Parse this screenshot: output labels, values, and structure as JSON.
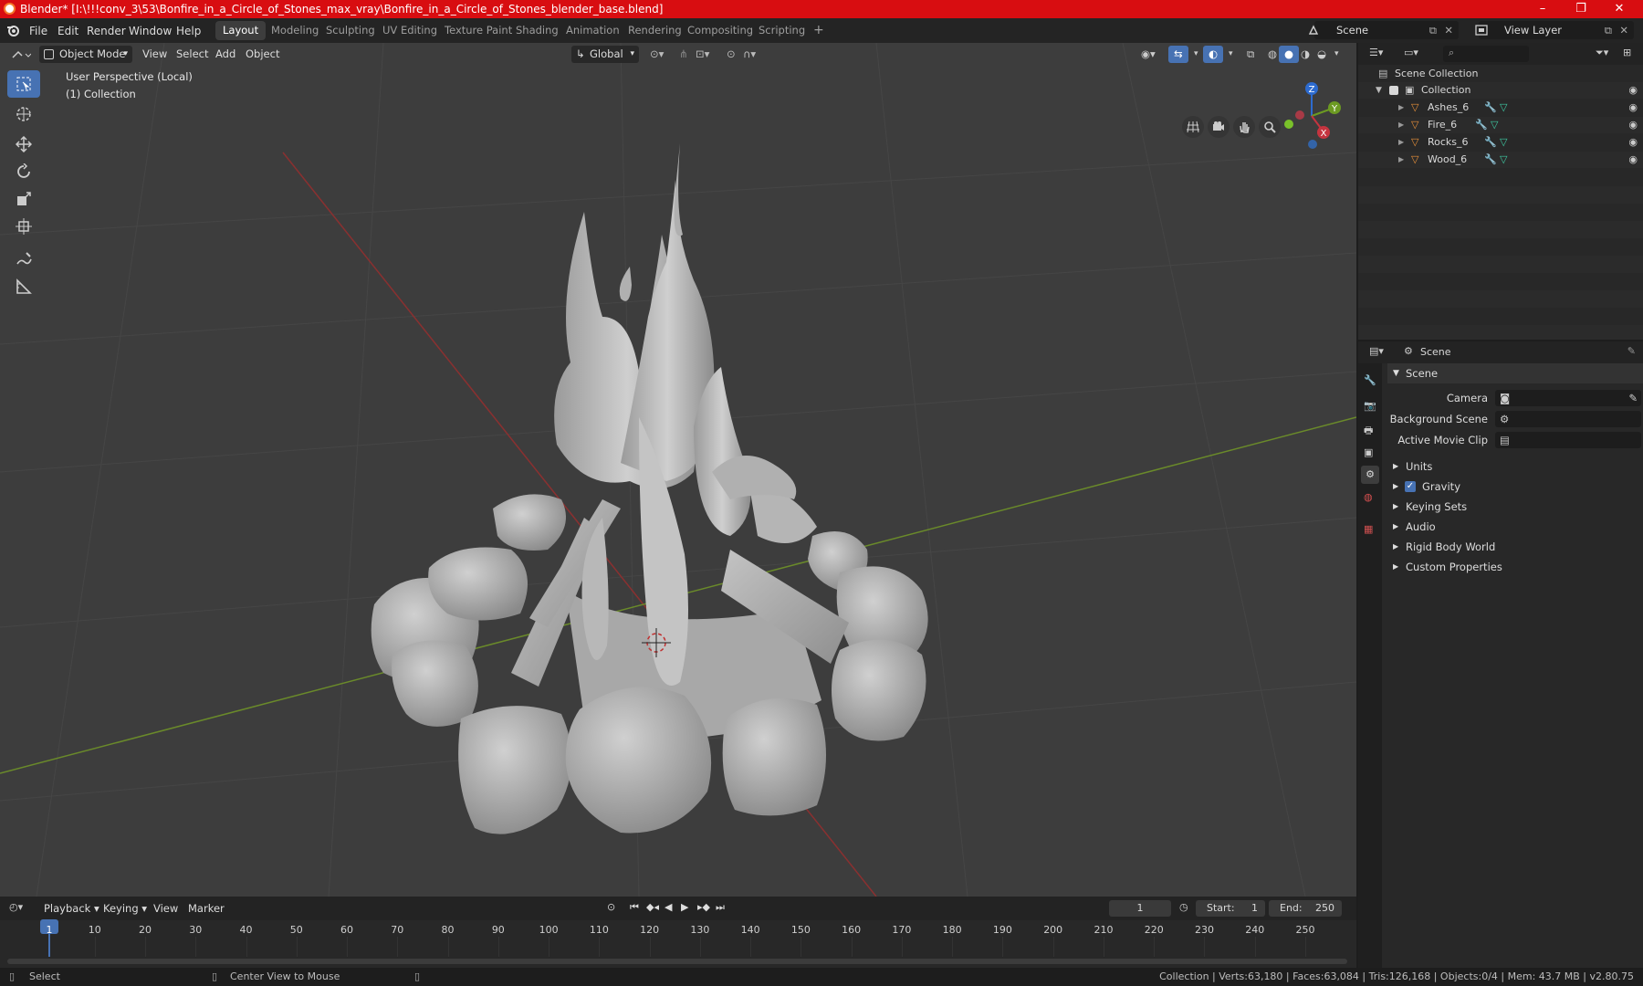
{
  "window": {
    "title": "Blender* [I:\\!!!conv_3\\53\\Bonfire_in_a_Circle_of_Stones_max_vray\\Bonfire_in_a_Circle_of_Stones_blender_base.blend]",
    "controls": {
      "minimize": "–",
      "maximize": "❐",
      "close": "✕"
    },
    "accent": "#d80d11"
  },
  "menu": [
    "File",
    "Edit",
    "Render",
    "Window",
    "Help"
  ],
  "workspaces": [
    "Layout",
    "Modeling",
    "Sculpting",
    "UV Editing",
    "Texture Paint",
    "Shading",
    "Animation",
    "Rendering",
    "Compositing",
    "Scripting"
  ],
  "active_workspace": "Layout",
  "add_workspace": "+",
  "scene_selector": "Scene",
  "view_layer_selector": "View Layer",
  "viewport": {
    "mode": "Object Mode",
    "menus": [
      "View",
      "Select",
      "Add",
      "Object"
    ],
    "orientation": "Global",
    "overlay_line1": "User Perspective (Local)",
    "overlay_line2": "(1) Collection",
    "gizmo": {
      "x": "X",
      "y": "Y",
      "z": "Z"
    },
    "background": "#3d3d3d"
  },
  "outliner": {
    "root": "Scene Collection",
    "collection": "Collection",
    "objects": [
      "Ashes_6",
      "Fire_6",
      "Rocks_6",
      "Wood_6"
    ]
  },
  "properties": {
    "header": "Scene",
    "panel_title": "Scene",
    "fields": [
      {
        "label": "Camera",
        "value": ""
      },
      {
        "label": "Background Scene",
        "value": ""
      },
      {
        "label": "Active Movie Clip",
        "value": ""
      }
    ],
    "sections": [
      "Units",
      "Gravity",
      "Keying Sets",
      "Audio",
      "Rigid Body World",
      "Custom Properties"
    ],
    "gravity_checked": true
  },
  "timeline": {
    "menus": [
      "Playback",
      "Keying",
      "View",
      "Marker"
    ],
    "current_frame": "1",
    "start_label": "Start:",
    "start": "1",
    "end_label": "End:",
    "end": "250",
    "ticks": [
      "1",
      "10",
      "20",
      "30",
      "40",
      "50",
      "60",
      "70",
      "80",
      "90",
      "100",
      "110",
      "120",
      "130",
      "140",
      "150",
      "160",
      "170",
      "180",
      "190",
      "200",
      "210",
      "220",
      "230",
      "240",
      "250"
    ]
  },
  "status": {
    "left1": "Select",
    "left2": "Center View to Mouse",
    "right": "Collection | Verts:63,180 | Faces:63,084 | Tris:126,168 | Objects:0/4 | Mem: 43.7 MB | v2.80.75"
  }
}
